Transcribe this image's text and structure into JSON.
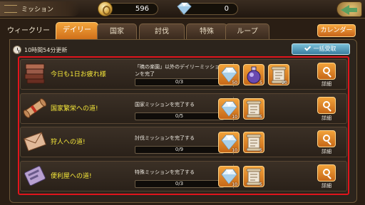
{
  "header": {
    "title": "ミッション",
    "gold": "596",
    "gems": "0"
  },
  "tabs": [
    {
      "label": "ウィークリー",
      "active": false
    },
    {
      "label": "デイリー",
      "active": true
    },
    {
      "label": "国家",
      "active": false
    },
    {
      "label": "討伐",
      "active": false
    },
    {
      "label": "特殊",
      "active": false
    },
    {
      "label": "ループ",
      "active": false
    }
  ],
  "calendar_label": "カレンダー",
  "refresh_text": "10時間54分更新",
  "bulk_receive_label": "一括受取",
  "detail_label": "詳細",
  "missions": [
    {
      "name": "今日も1日お疲れ様",
      "desc": "「暁の楽園」以外のデイリーミッションを完了",
      "progress": "0/3",
      "progress_fraction": 0,
      "icon": "book-icon",
      "rewards": [
        {
          "icon": "gem-icon",
          "qty": "50"
        },
        {
          "icon": "potion-icon",
          "qty": "5"
        },
        {
          "icon": "scroll-icon",
          "qty": "20"
        }
      ]
    },
    {
      "name": "国家繁栄への道!",
      "desc": "国家ミッションを完了する",
      "progress": "0/5",
      "progress_fraction": 0,
      "icon": "rolled-scroll-icon",
      "rewards": [
        {
          "icon": "gem-icon",
          "qty": "10"
        },
        {
          "icon": "scroll-icon",
          "qty": "5"
        }
      ]
    },
    {
      "name": "狩人への道!",
      "desc": "討伐ミッションを完了する",
      "progress": "0/9",
      "progress_fraction": 0,
      "icon": "envelope-icon",
      "rewards": [
        {
          "icon": "gem-icon",
          "qty": "10"
        },
        {
          "icon": "scroll-icon",
          "qty": "5"
        }
      ]
    },
    {
      "name": "便利屋への道!",
      "desc": "特殊ミッションを完了する",
      "progress": "0/3",
      "progress_fraction": 0,
      "icon": "card-icon",
      "rewards": [
        {
          "icon": "gem-icon",
          "qty": "10"
        },
        {
          "icon": "scroll-icon",
          "qty": "5"
        }
      ]
    }
  ]
}
